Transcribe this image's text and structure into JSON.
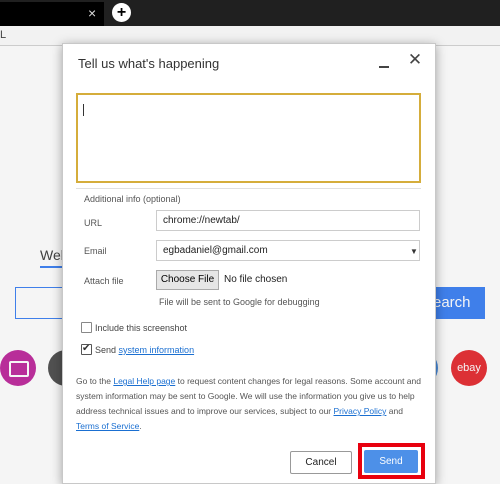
{
  "browser": {
    "tab_close": "×",
    "new_tab": "+",
    "address_fragment": "L"
  },
  "background_page": {
    "search_tab": "Web",
    "search_button": "earch",
    "shortcut_ebay": "ebay"
  },
  "dialog": {
    "title": "Tell us what's happening",
    "minimize_icon": "minimize-icon",
    "close_icon": "close-icon",
    "description_value": "",
    "additional_info_label": "Additional info (optional)",
    "url_label": "URL",
    "url_value": "chrome://newtab/",
    "email_label": "Email",
    "email_value": "egbadaniel@gmail.com",
    "attach_label": "Attach file",
    "choose_file": "Choose File",
    "no_file": "No file chosen",
    "debug_note": "File will be sent to Google for debugging",
    "include_screenshot": "Include this screenshot",
    "include_screenshot_checked": false,
    "send_prefix": "Send",
    "system_information_link": "system information",
    "send_system_info_checked": true,
    "legal_1": "Go to the",
    "legal_help_link": "Legal Help page",
    "legal_2": "to request content changes for legal reasons. Some account and system information may be sent to Google. We will use the information you give us to help address technical issues and to improve our services, subject to our",
    "privacy_link": "Privacy Policy",
    "legal_3": "and",
    "tos_link": "Terms of Service",
    "legal_4": ".",
    "cancel": "Cancel",
    "send": "Send",
    "accent_color": "#4d90e8",
    "highlight_color": "#e8000e"
  }
}
